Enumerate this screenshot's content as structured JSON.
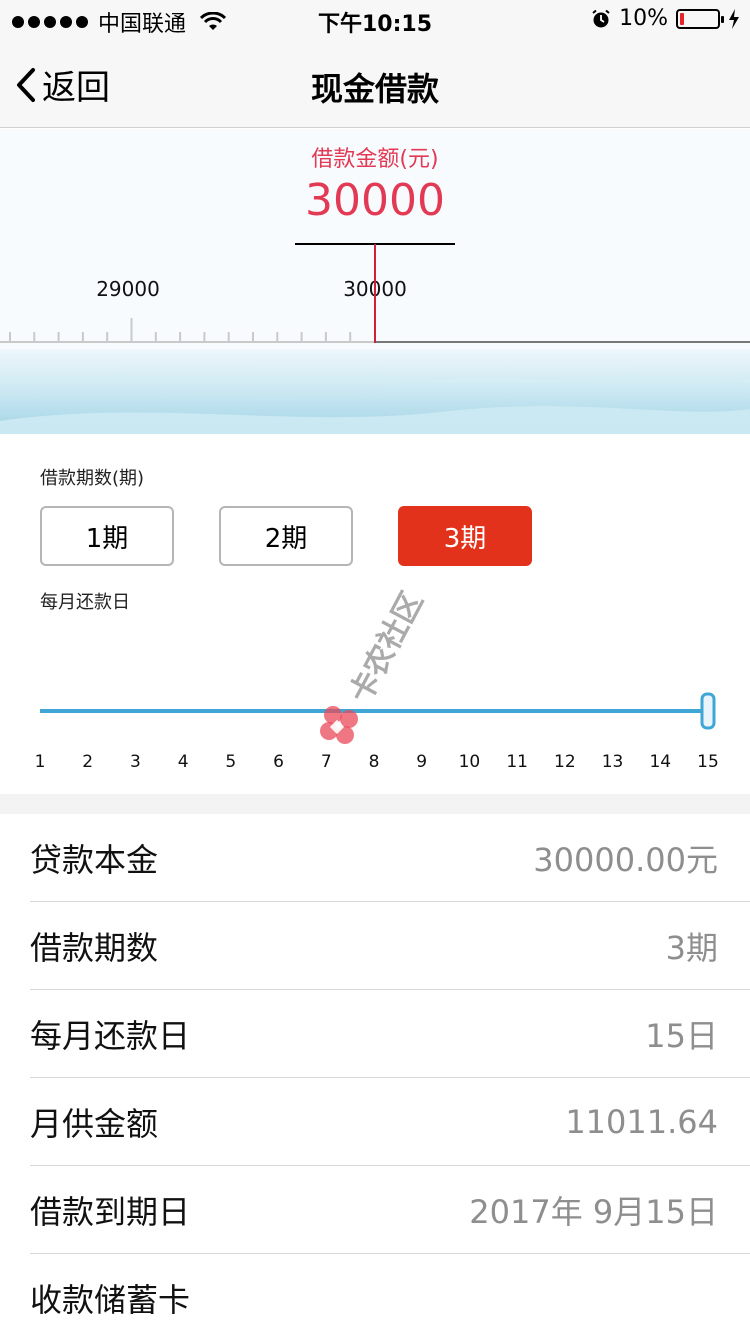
{
  "status_bar": {
    "carrier": "中国联通",
    "time": "下午10:15",
    "battery_percent": "10%",
    "battery_level": 0.1,
    "icons": [
      "signal-dots-icon",
      "wifi-icon",
      "alarm-icon",
      "battery-icon",
      "charging-bolt-icon"
    ]
  },
  "nav": {
    "back_label": "返回",
    "title": "现金借款"
  },
  "amount": {
    "label": "借款金额(元)",
    "value": "30000",
    "ruler_marks": [
      "29000",
      "30000"
    ],
    "accent_color": "#e23a55"
  },
  "term": {
    "label": "借款期数(期)",
    "options": [
      "1期",
      "2期",
      "3期"
    ],
    "selected_index": 2,
    "active_color": "#e3321b"
  },
  "payday": {
    "label": "每月还款日",
    "ticks": [
      "1",
      "2",
      "3",
      "4",
      "5",
      "6",
      "7",
      "8",
      "9",
      "10",
      "11",
      "12",
      "13",
      "14",
      "15"
    ],
    "selected": 15,
    "track_color": "#3fa6d6"
  },
  "watermark": {
    "text": "卡农社区"
  },
  "details": [
    {
      "label": "贷款本金",
      "value": "30000.00元"
    },
    {
      "label": "借款期数",
      "value": "3期"
    },
    {
      "label": "每月还款日",
      "value": "15日"
    },
    {
      "label": "月供金额",
      "value": "11011.64"
    },
    {
      "label": "借款到期日",
      "value": "2017年 9月15日"
    },
    {
      "label": "收款储蓄卡",
      "value": ""
    }
  ]
}
